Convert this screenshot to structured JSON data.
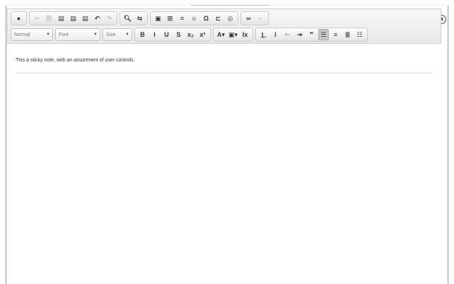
{
  "window": {
    "close_icon": "close-circle-icon"
  },
  "toolbar": {
    "row1": [
      {
        "name": "source-icon",
        "glyph": "●",
        "state": "enabled"
      },
      {
        "name": "cut-icon",
        "glyph": "✂",
        "state": "disabled"
      },
      {
        "name": "copy-icon",
        "glyph": "⎘",
        "state": "disabled"
      },
      {
        "name": "paste-icon",
        "glyph": "▤",
        "state": "enabled"
      },
      {
        "name": "paste-text-icon",
        "glyph": "▤",
        "state": "enabled"
      },
      {
        "name": "paste-word-icon",
        "glyph": "▤",
        "state": "enabled"
      },
      {
        "name": "undo-icon",
        "glyph": "↶",
        "state": "enabled"
      },
      {
        "name": "redo-icon",
        "glyph": "↷",
        "state": "disabled"
      },
      {
        "name": "find-icon",
        "glyph": "🔍︎",
        "state": "enabled"
      },
      {
        "name": "replace-icon",
        "glyph": "⇆",
        "state": "enabled"
      },
      {
        "name": "image-icon",
        "glyph": "▣",
        "state": "enabled"
      },
      {
        "name": "table-icon",
        "glyph": "⊞",
        "state": "enabled"
      },
      {
        "name": "horizontal-rule-icon",
        "glyph": "≡",
        "state": "enabled"
      },
      {
        "name": "smiley-icon",
        "glyph": "☺",
        "state": "enabled"
      },
      {
        "name": "special-char-icon",
        "glyph": "Ω",
        "state": "enabled"
      },
      {
        "name": "page-break-icon",
        "glyph": "⊏",
        "state": "enabled"
      },
      {
        "name": "iframe-icon",
        "glyph": "◎",
        "state": "enabled"
      },
      {
        "name": "link-icon",
        "glyph": "∞",
        "state": "enabled"
      },
      {
        "name": "unlink-icon",
        "glyph": "⌐",
        "state": "disabled"
      }
    ],
    "format_combo": "Normal",
    "font_combo": "Font",
    "size_combo": "Size",
    "row2": [
      {
        "name": "bold-icon",
        "glyph": "B",
        "state": "enabled"
      },
      {
        "name": "italic-icon",
        "glyph": "I",
        "state": "enabled"
      },
      {
        "name": "underline-icon",
        "glyph": "U",
        "state": "enabled"
      },
      {
        "name": "strikethrough-icon",
        "glyph": "S",
        "state": "enabled"
      },
      {
        "name": "subscript-icon",
        "glyph": "x₂",
        "state": "enabled"
      },
      {
        "name": "superscript-icon",
        "glyph": "x²",
        "state": "enabled"
      },
      {
        "name": "text-color-icon",
        "glyph": "A▾",
        "state": "enabled"
      },
      {
        "name": "bg-color-icon",
        "glyph": "▣▾",
        "state": "enabled"
      },
      {
        "name": "remove-format-icon",
        "glyph": "Ix",
        "state": "enabled"
      },
      {
        "name": "numbered-list-icon",
        "glyph": "⒈",
        "state": "enabled"
      },
      {
        "name": "bulleted-list-icon",
        "glyph": "⁝",
        "state": "enabled"
      },
      {
        "name": "outdent-icon",
        "glyph": "⇤",
        "state": "disabled"
      },
      {
        "name": "indent-icon",
        "glyph": "⇥",
        "state": "enabled"
      },
      {
        "name": "blockquote-icon",
        "glyph": "❞",
        "state": "enabled"
      },
      {
        "name": "align-left-icon",
        "glyph": "☰",
        "state": "active"
      },
      {
        "name": "align-center-icon",
        "glyph": "≡",
        "state": "enabled"
      },
      {
        "name": "align-right-icon",
        "glyph": "≣",
        "state": "enabled"
      },
      {
        "name": "justify-icon",
        "glyph": "☷",
        "state": "enabled"
      }
    ]
  },
  "editor": {
    "text": "This a sticky note, with an assortment of user controls."
  }
}
